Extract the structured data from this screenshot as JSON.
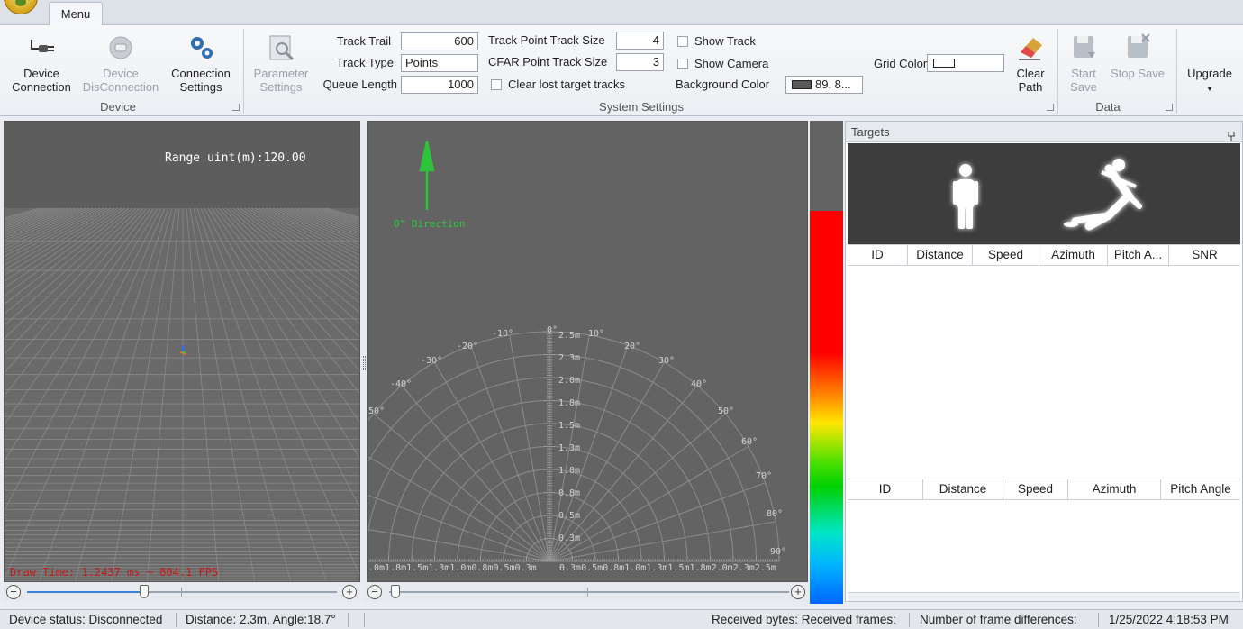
{
  "ribbon": {
    "tab": "Menu",
    "device_group": {
      "label": "Device",
      "connect": [
        "Device",
        "Connection"
      ],
      "disconnect": [
        "Device",
        "DisConnection"
      ],
      "settings": [
        "Connection",
        "Settings"
      ]
    },
    "system_group": {
      "label": "System Settings",
      "parameter": [
        "Parameter",
        "Settings"
      ],
      "track_trail_label": "Track Trail",
      "track_trail_value": "600",
      "track_type_label": "Track Type",
      "track_type_value": "Points",
      "queue_length_label": "Queue Length",
      "queue_length_value": "1000",
      "track_point_size_label": "Track Point Track Size",
      "track_point_size_value": "4",
      "cfar_point_size_label": "CFAR  Point Track Size",
      "cfar_point_size_value": "3",
      "clear_lost_label": "Clear lost target tracks",
      "show_track_label": "Show Track",
      "show_camera_label": "Show Camera",
      "background_color_label": "Background Color",
      "background_color_value": "89, 8...",
      "background_swatch": "#595959",
      "grid_color_label": "Grid Color",
      "grid_swatch": "#ffffff",
      "clear_path": [
        "Clear",
        "Path"
      ]
    },
    "data_group": {
      "label": "Data",
      "start_save": [
        "Start",
        "Save"
      ],
      "stop_save": "Stop Save"
    },
    "upgrade": "Upgrade"
  },
  "view3d": {
    "range_text": "Range uint(m):120.00",
    "draw_time": "Draw Time: 1.2437 ms ~ 804.1 FPS"
  },
  "polar": {
    "direction_label": "0° Direction",
    "angle_labels": [
      "-10°",
      "0°",
      "10°",
      "-20°",
      "20°",
      "-30°",
      "30°",
      "-40°",
      "40°",
      "50°",
      "50°",
      "60°",
      "70°",
      "80°",
      "90°"
    ],
    "radial_labels": [
      "2.5m",
      "2.3m",
      "2.0m",
      "1.8m",
      "1.5m",
      "1.3m",
      "1.0m",
      "0.8m",
      "0.5m",
      "0.3m"
    ],
    "bottom_left": ".0m1.8m1.5m1.3m1.0m0.8m0.5m0.3m",
    "bottom_right": "0.3m0.5m0.8m1.0m1.3m1.5m1.8m2.0m2.3m2.5m"
  },
  "targets": {
    "title": "Targets",
    "table1_headers": [
      "ID",
      "Distance",
      "Speed",
      "Azimuth",
      "Pitch A...",
      "SNR"
    ],
    "table2_headers": [
      "ID",
      "Distance",
      "Speed",
      "Azimuth",
      "Pitch Angle"
    ]
  },
  "status": {
    "device": "Device status: Disconnected",
    "distance": "Distance: 2.3m, Angle:18.7°",
    "received": "Received bytes: Received frames:",
    "frame_diff": "Number of frame differences:",
    "datetime": "1/25/2022 4:18:53 PM"
  }
}
